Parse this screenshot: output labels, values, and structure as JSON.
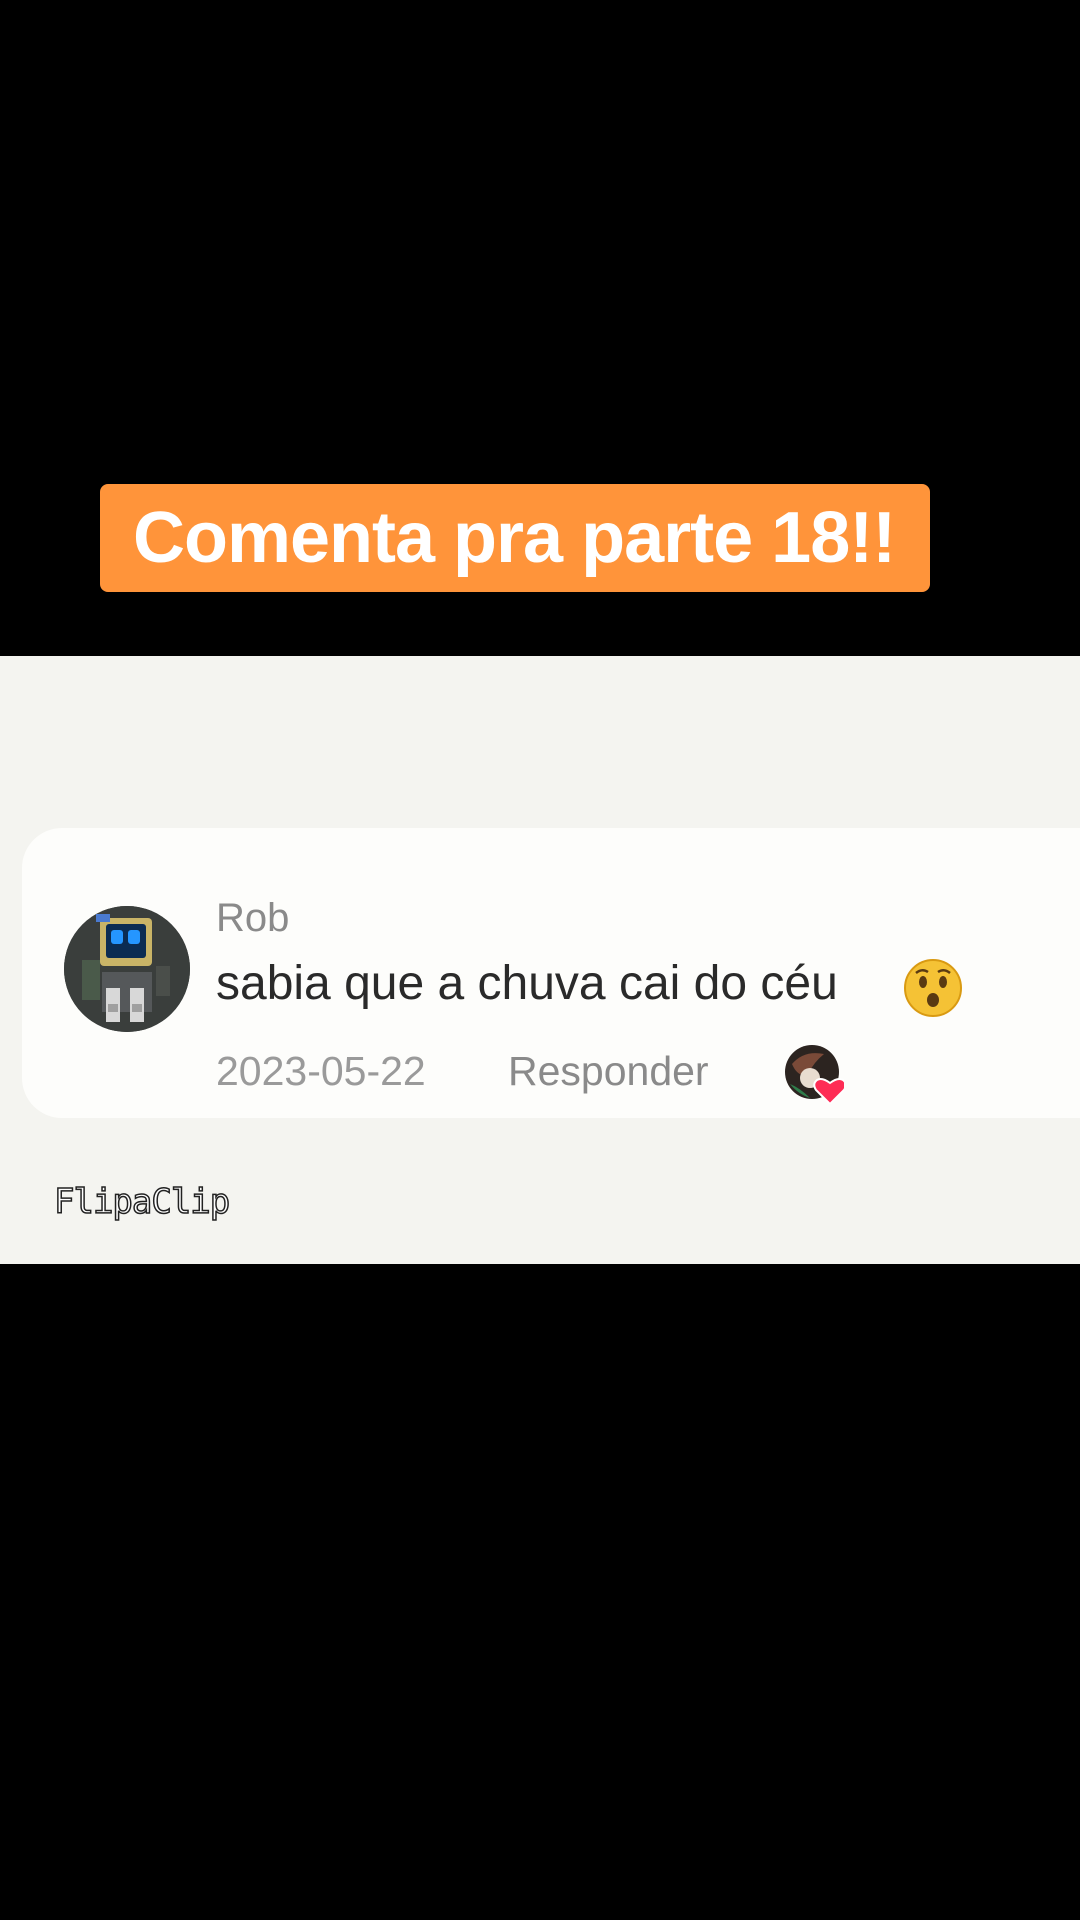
{
  "caption": {
    "text": "Comenta pra parte 18!!",
    "background_color": "#ff943a",
    "text_color": "#ffffff"
  },
  "comment": {
    "username": "Rob",
    "text": "sabia que a chuva cai do céu",
    "emoji_icon": "hushed-face-icon",
    "date": "2023-05-22",
    "reply_label": "Responder",
    "liked_by_creator_icon": "creator-liked-heart-icon",
    "heart_color": "#fe2c55"
  },
  "watermark": {
    "text": "FlipaClip"
  }
}
